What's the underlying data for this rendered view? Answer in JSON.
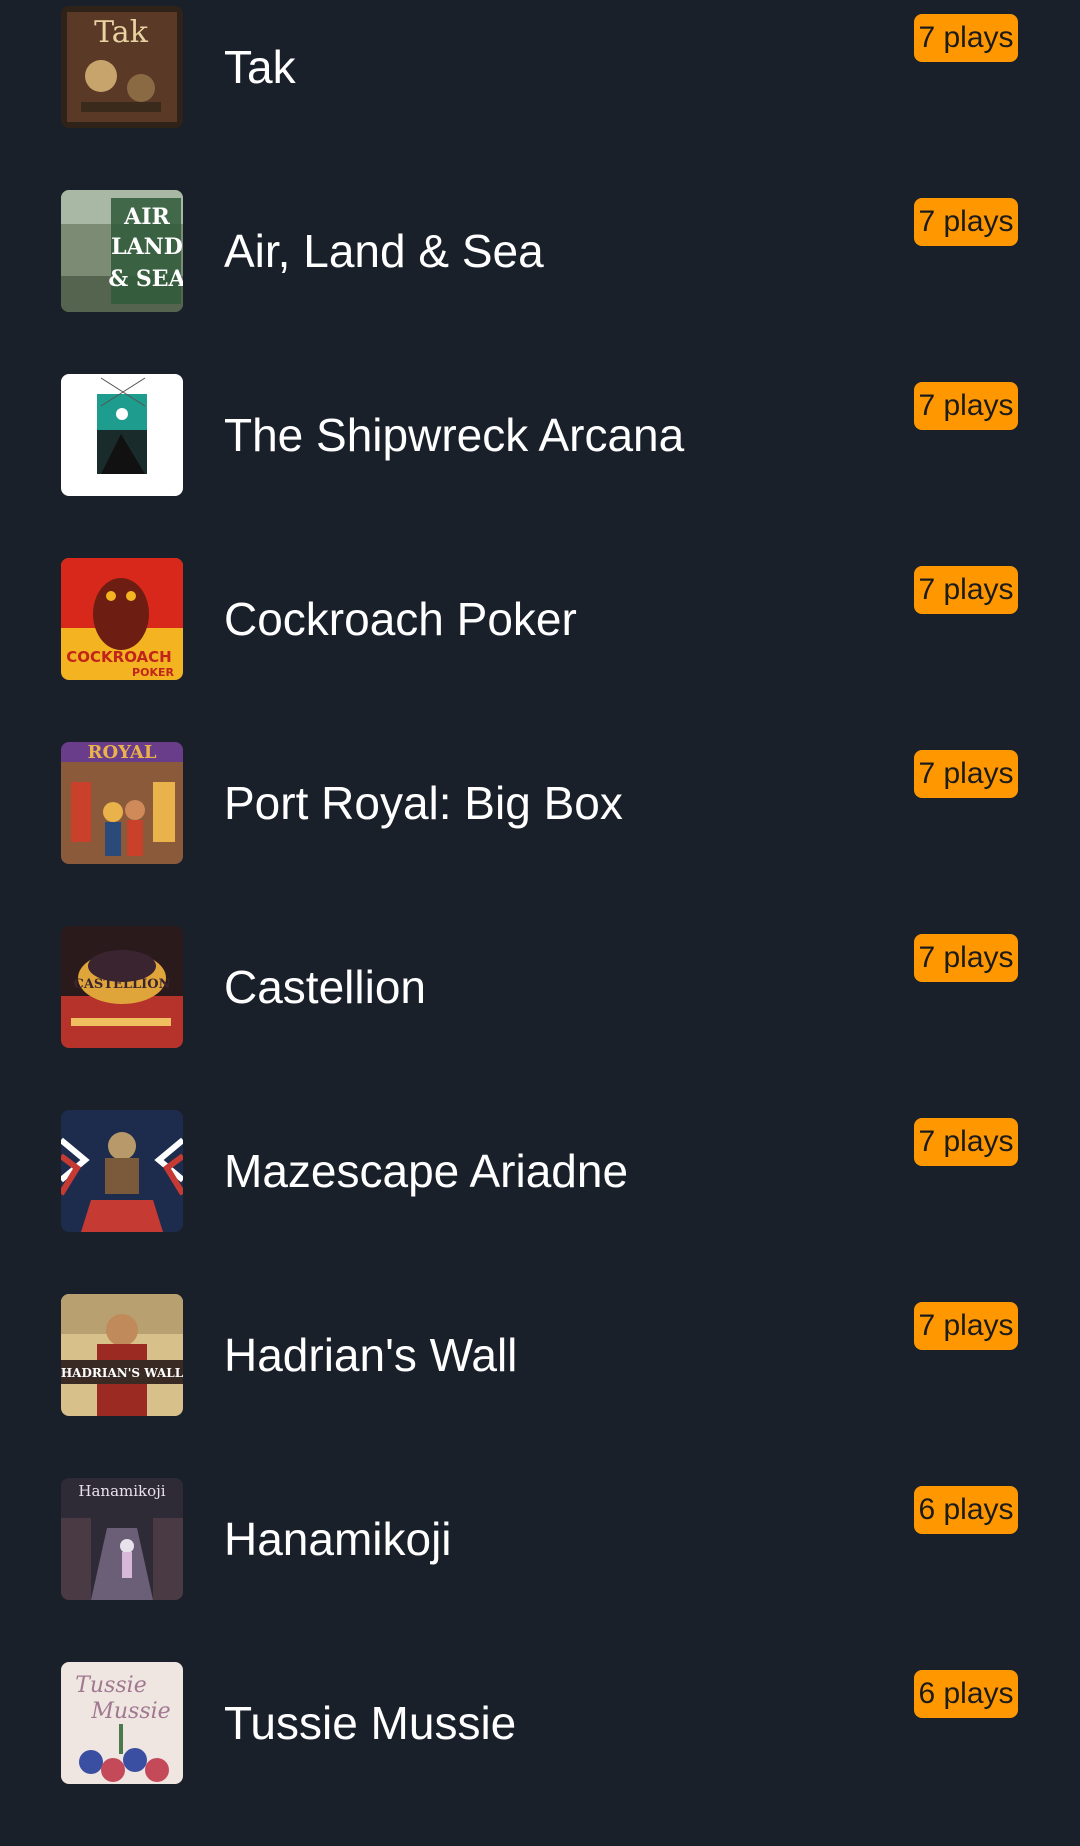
{
  "games": [
    {
      "name": "Tak",
      "plays": "7 plays",
      "cover": {
        "label": "Tak",
        "colors": [
          "#5a3a26",
          "#2e2219",
          "#c7a46b"
        ]
      }
    },
    {
      "name": "Air, Land & Sea",
      "plays": "7 plays",
      "cover": {
        "label": "AIR LAND & SEA",
        "colors": [
          "#7b8b74",
          "#2f5a39",
          "#ffffff"
        ]
      }
    },
    {
      "name": "The Shipwreck Arcana",
      "plays": "7 plays",
      "cover": {
        "label": "",
        "colors": [
          "#ffffff",
          "#1e9c8e",
          "#111111"
        ]
      }
    },
    {
      "name": "Cockroach Poker",
      "plays": "7 plays",
      "cover": {
        "label": "COCKROACH POKER",
        "colors": [
          "#d8281b",
          "#f4b321",
          "#6d1d12"
        ]
      }
    },
    {
      "name": "Port Royal: Big Box",
      "plays": "7 plays",
      "cover": {
        "label": "ROYAL",
        "colors": [
          "#6a3d8a",
          "#c9402b",
          "#e9b24b"
        ]
      }
    },
    {
      "name": "Castellion",
      "plays": "7 plays",
      "cover": {
        "label": "CASTELLION",
        "colors": [
          "#2a1a1c",
          "#e0a53a",
          "#b6332c"
        ]
      }
    },
    {
      "name": "Mazescape Ariadne",
      "plays": "7 plays",
      "cover": {
        "label": "",
        "colors": [
          "#1d2b4d",
          "#c63a34",
          "#ffffff"
        ]
      }
    },
    {
      "name": "Hadrian's Wall",
      "plays": "7 plays",
      "cover": {
        "label": "HADRIAN'S WALL",
        "colors": [
          "#9a2a22",
          "#d8c08a",
          "#3a2a24"
        ]
      }
    },
    {
      "name": "Hanamikoji",
      "plays": "6 plays",
      "cover": {
        "label": "Hanamikoji",
        "colors": [
          "#2e2a36",
          "#6b5f77",
          "#e8e2ec"
        ]
      }
    },
    {
      "name": "Tussie Mussie",
      "plays": "6 plays",
      "cover": {
        "label": "Tussie Mussie",
        "colors": [
          "#efe6e2",
          "#3a4fa2",
          "#c44a5a"
        ]
      }
    }
  ],
  "badge_color": "#ff9800",
  "background_color": "#1a202a"
}
